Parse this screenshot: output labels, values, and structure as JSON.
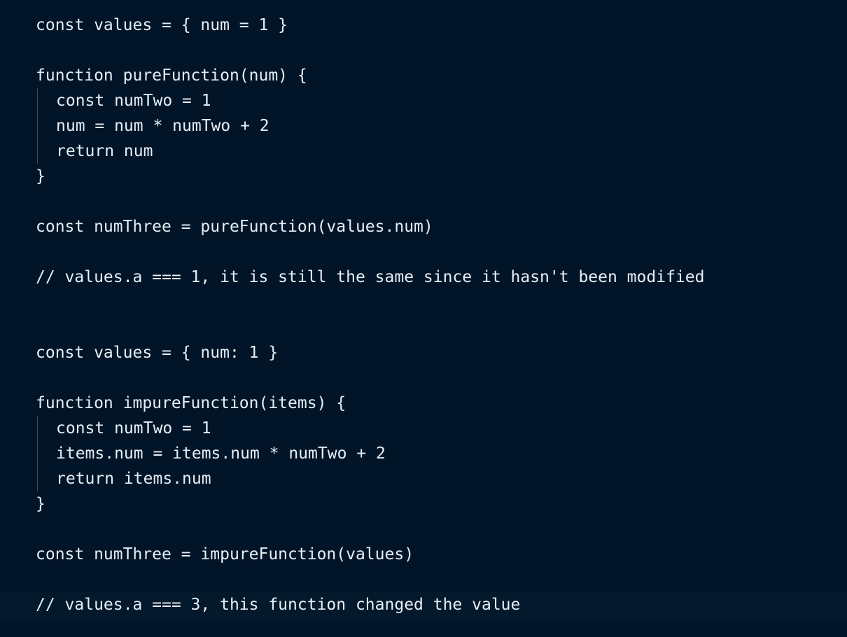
{
  "editor": {
    "lines": [
      "const values = { num = 1 }",
      "function pureFunction(num) {",
      "const numTwo = 1",
      "num = num * numTwo + 2",
      "return num",
      "}",
      "const numThree = pureFunction(values.num)",
      "// values.a === 1, it is still the same since it hasn't been modified",
      "const values = { num: 1 }",
      "function impureFunction(items) {",
      "const numTwo = 1",
      "items.num = items.num * numTwo + 2",
      "return items.num",
      "}",
      "const numThree = impureFunction(values)",
      "// values.a === 3, this function changed the value"
    ]
  }
}
